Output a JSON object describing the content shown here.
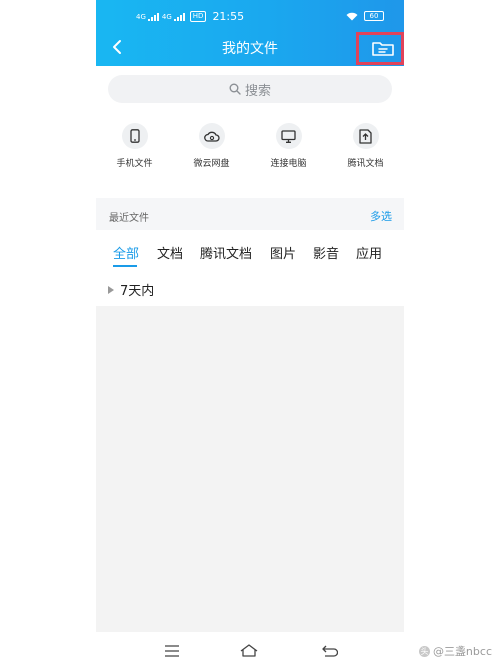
{
  "status_bar": {
    "signal1": "4G",
    "signal2": "4G",
    "network_tag": "HD",
    "time": "21:55",
    "battery": "60"
  },
  "header": {
    "title": "我的文件"
  },
  "search": {
    "placeholder": "搜索"
  },
  "quick_entries": [
    {
      "label": "手机文件",
      "icon": "phone-icon"
    },
    {
      "label": "微云网盘",
      "icon": "cloud-icon"
    },
    {
      "label": "连接电脑",
      "icon": "monitor-icon"
    },
    {
      "label": "腾讯文档",
      "icon": "doc-upload-icon"
    }
  ],
  "recent": {
    "title": "最近文件",
    "multi_select": "多选"
  },
  "tabs": [
    {
      "label": "全部",
      "active": true
    },
    {
      "label": "文档",
      "active": false
    },
    {
      "label": "腾讯文档",
      "active": false
    },
    {
      "label": "图片",
      "active": false
    },
    {
      "label": "影音",
      "active": false
    },
    {
      "label": "应用",
      "active": false
    }
  ],
  "group": {
    "label": "7天内"
  },
  "watermark": {
    "text": "@三盞nbcc",
    "logo": "头"
  },
  "colors": {
    "header_start": "#19b7f2",
    "header_end": "#1f97ea",
    "accent": "#1a9be8",
    "highlight_box": "#e0435a"
  }
}
